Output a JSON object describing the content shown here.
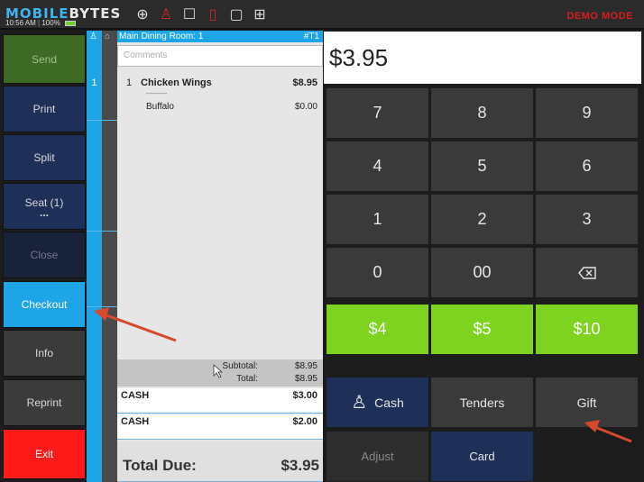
{
  "topbar": {
    "logo_a": "MOBILE",
    "logo_b": "BYTES",
    "time": "10:56 AM",
    "battery": "100%",
    "demo_mode": "DEMO MODE"
  },
  "sidebar": {
    "send": "Send",
    "print": "Print",
    "split": "Split",
    "seat": "Seat (1)",
    "seat_dots": "...",
    "close": "Close",
    "checkout": "Checkout",
    "info": "Info",
    "reprint": "Reprint",
    "exit": "Exit"
  },
  "seat": {
    "number": "1"
  },
  "ticket": {
    "room": "Main Dining Room: 1",
    "table": "#T1",
    "comments_placeholder": "Comments",
    "item_qty": "1",
    "item_name": "Chicken Wings",
    "item_price": "$8.95",
    "modifier_dashes": "----------",
    "modifier_name": "Buffalo",
    "modifier_price": "$0.00",
    "subtotal_label": "Subtotal:",
    "subtotal_value": "$8.95",
    "total_label": "Total:",
    "total_value": "$8.95",
    "payments": [
      {
        "label": "CASH",
        "amount": "$3.00"
      },
      {
        "label": "CASH",
        "amount": "$2.00"
      }
    ],
    "total_due_label": "Total Due:",
    "total_due_value": "$3.95"
  },
  "keypad": {
    "amount": "$3.95",
    "keys": [
      "7",
      "8",
      "9",
      "4",
      "5",
      "6",
      "1",
      "2",
      "3",
      "0",
      "00"
    ],
    "quick": [
      "$4",
      "$5",
      "$10"
    ],
    "cash": "Cash",
    "tenders": "Tenders",
    "gift": "Gift",
    "adjust": "Adjust",
    "card": "Card"
  },
  "colors": {
    "blue": "#1ea5e8",
    "green": "#7ed321",
    "exit_red": "#ff1a1a",
    "navy": "#1f3058",
    "demo_red": "#d71e1e"
  }
}
